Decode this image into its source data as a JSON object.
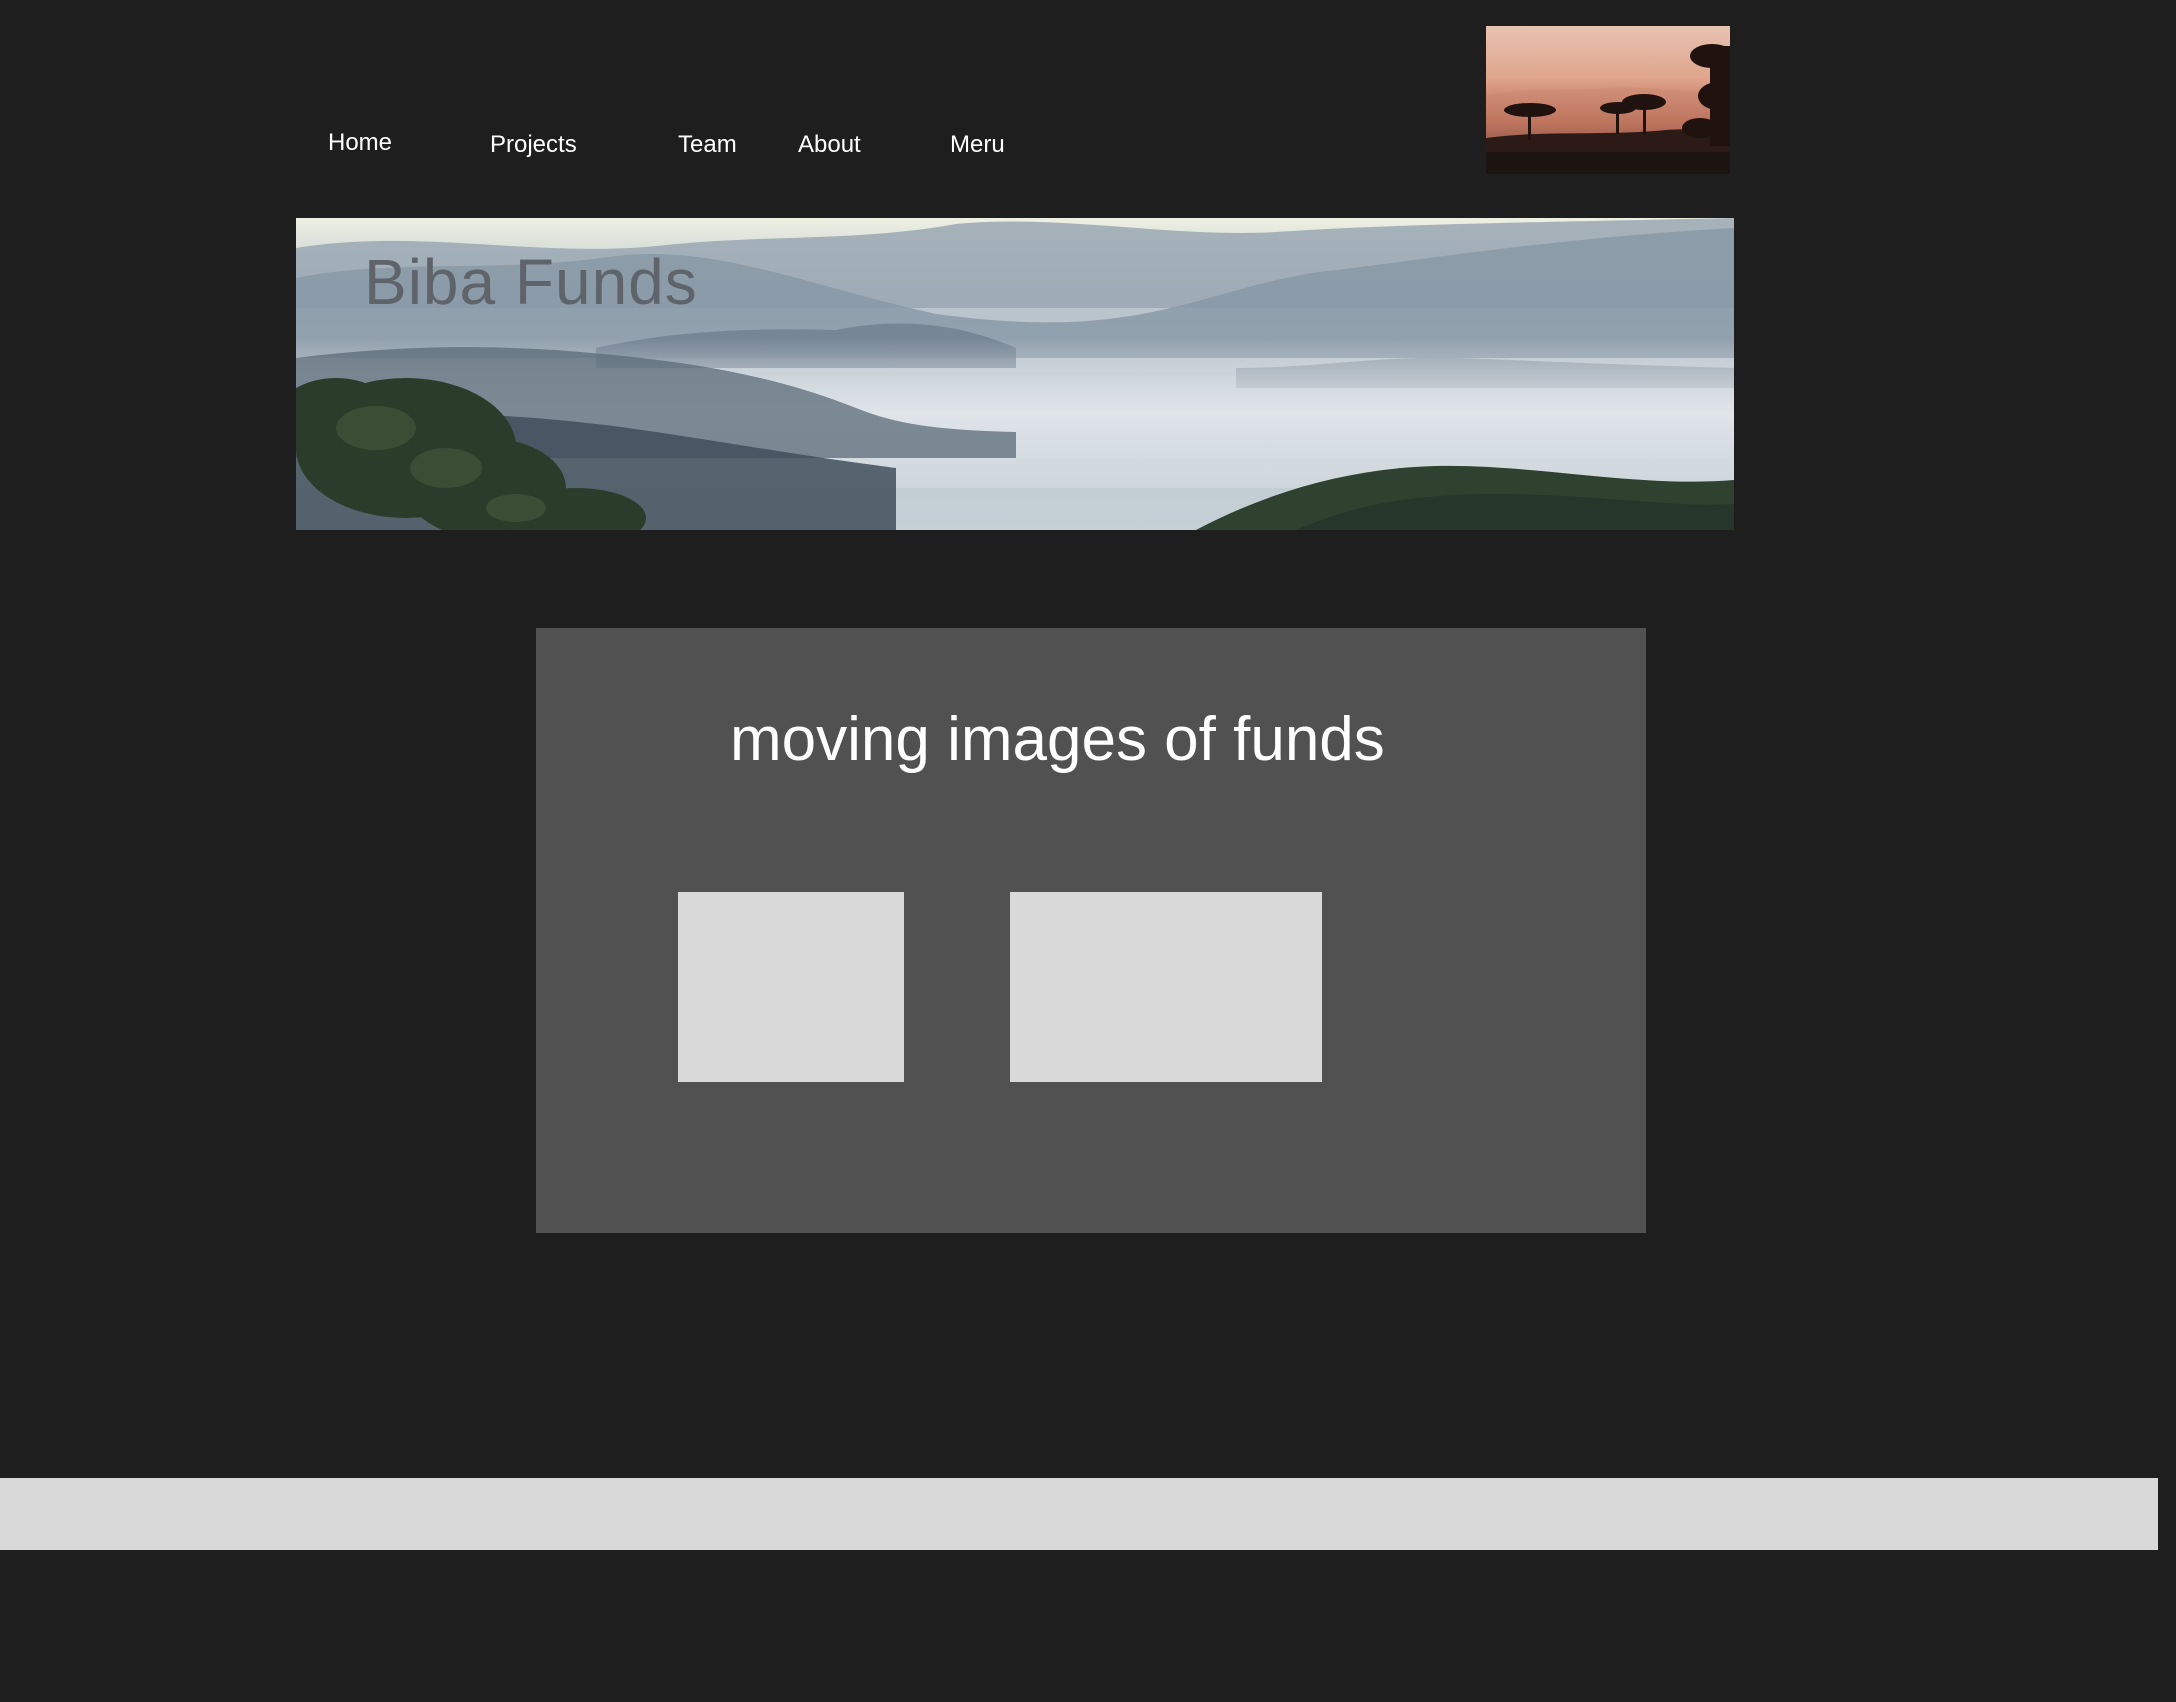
{
  "nav": {
    "items": [
      {
        "label": "Home"
      },
      {
        "label": "Projects"
      },
      {
        "label": "Team"
      },
      {
        "label": "About"
      },
      {
        "label": "Meru"
      }
    ]
  },
  "header": {
    "logo_image": "sunset-acacia-trees-photo"
  },
  "hero": {
    "title": "Biba Funds",
    "image": "misty-valley-landscape-photo"
  },
  "funds": {
    "heading": "moving images of funds",
    "slots": [
      "image-placeholder",
      "image-placeholder"
    ]
  },
  "colors": {
    "background": "#1e1e1e",
    "panel": "#515151",
    "placeholder": "#d9d9d9",
    "text": "#ffffff",
    "hero_title": "#5e646a"
  }
}
